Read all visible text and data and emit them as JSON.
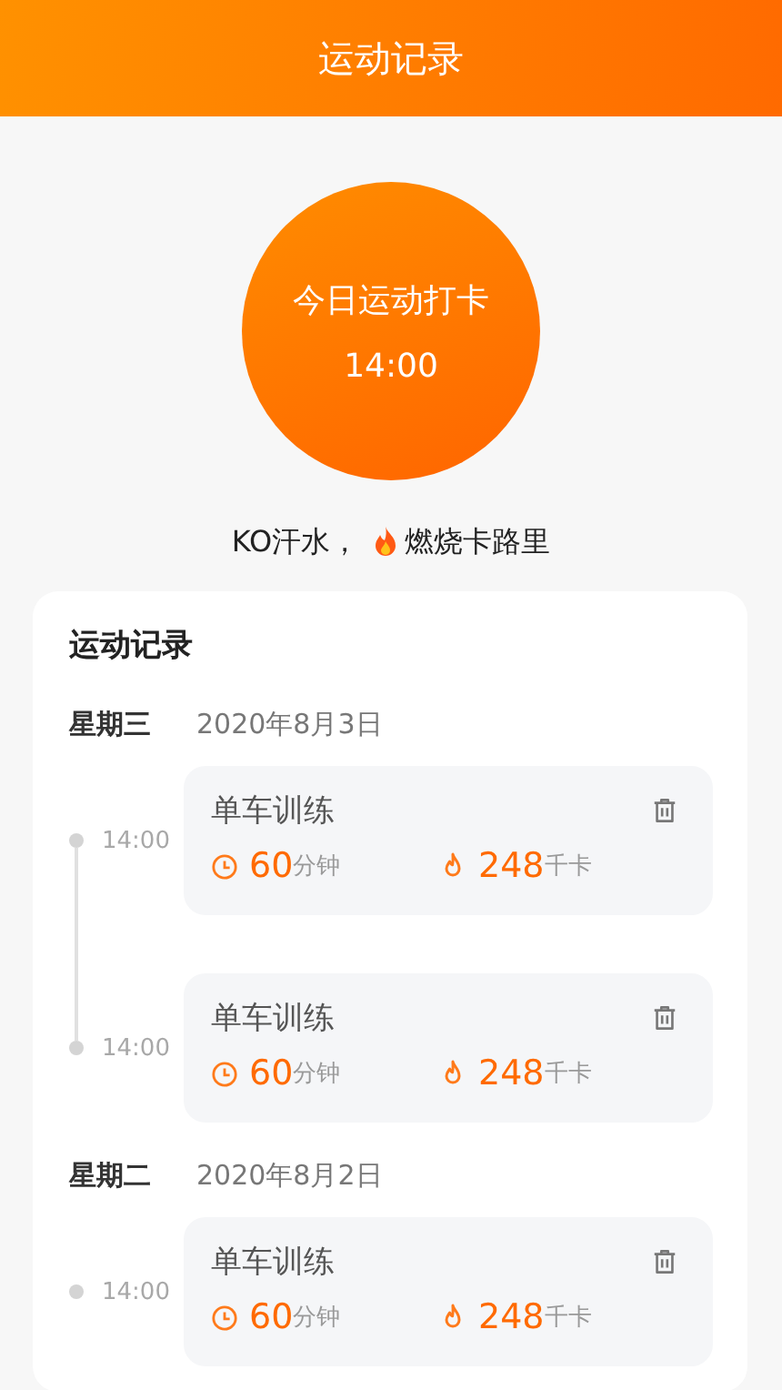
{
  "header": {
    "title": "运动记录"
  },
  "checkin": {
    "label": "今日运动打卡",
    "time": "14:00"
  },
  "slogan": {
    "before": "KO汗水，",
    "after": "燃烧卡路里"
  },
  "records": {
    "title": "运动记录",
    "days": [
      {
        "weekday": "星期三",
        "date": "2020年8月3日",
        "entries": [
          {
            "time": "14:00",
            "name": "单车训练",
            "duration": "60",
            "duration_unit": "分钟",
            "calories": "248",
            "calories_unit": "千卡"
          },
          {
            "time": "14:00",
            "name": "单车训练",
            "duration": "60",
            "duration_unit": "分钟",
            "calories": "248",
            "calories_unit": "千卡"
          }
        ]
      },
      {
        "weekday": "星期二",
        "date": "2020年8月2日",
        "entries": [
          {
            "time": "14:00",
            "name": "单车训练",
            "duration": "60",
            "duration_unit": "分钟",
            "calories": "248",
            "calories_unit": "千卡"
          }
        ]
      }
    ]
  }
}
